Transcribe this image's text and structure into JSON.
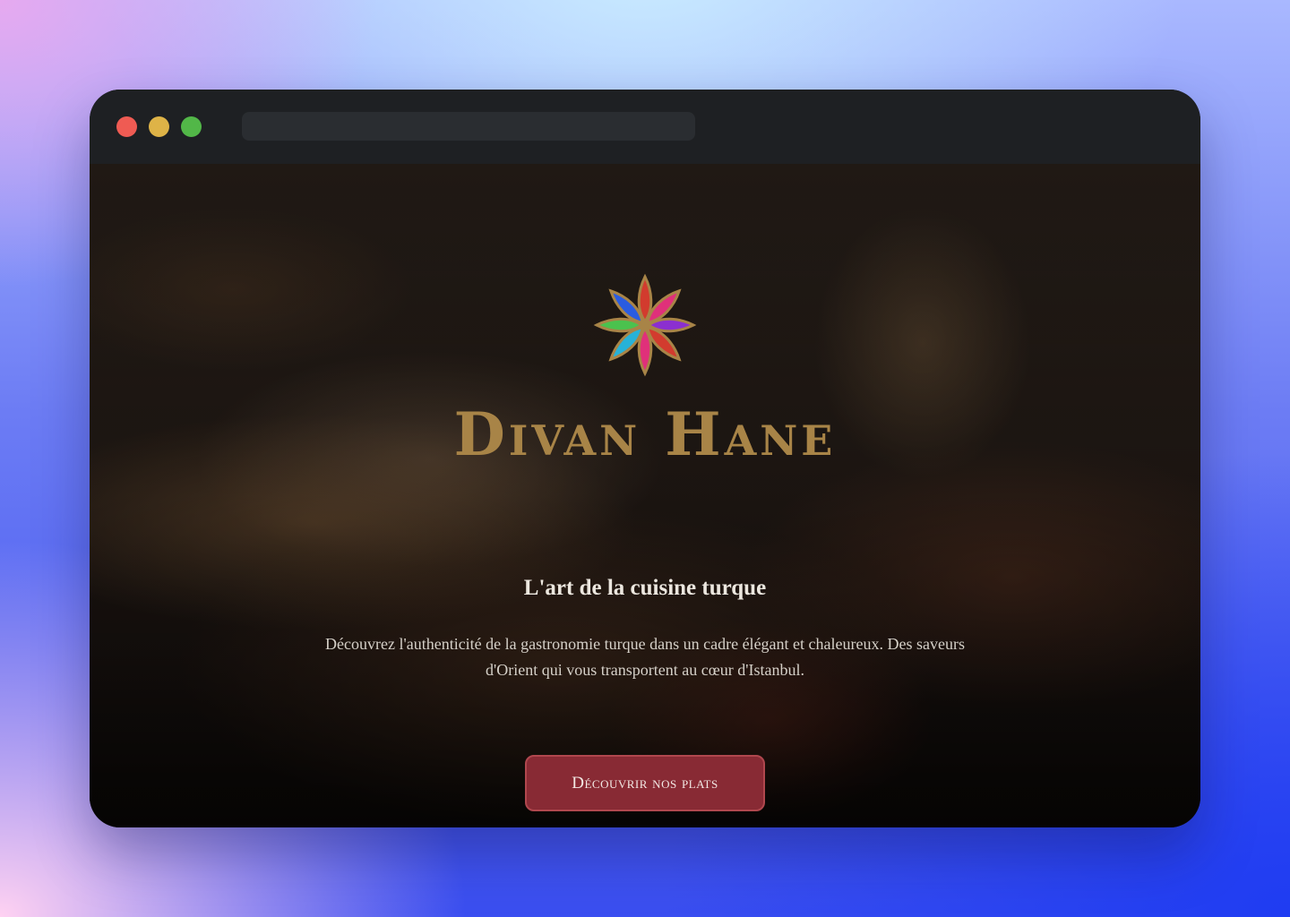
{
  "window": {
    "controls": [
      "close",
      "minimize",
      "maximize"
    ],
    "address_bar": ""
  },
  "hero": {
    "logo_icon": "floral-emblem-icon",
    "brand": "Divan Hane",
    "tagline": "L'art de la cuisine turque",
    "description": "Découvrez l'authenticité de la gastronomie turque dans un cadre élégant et chaleureux. Des saveurs d'Orient qui vous transportent au cœur d'Istanbul.",
    "cta_label": "Découvrir nos plats",
    "scroll_icon": "mouse-scroll-icon"
  },
  "colors": {
    "gold": "#a88447",
    "cta_background": "#882a34",
    "close": "#ef5b53",
    "minimize": "#deb347",
    "maximize": "#52b748"
  }
}
